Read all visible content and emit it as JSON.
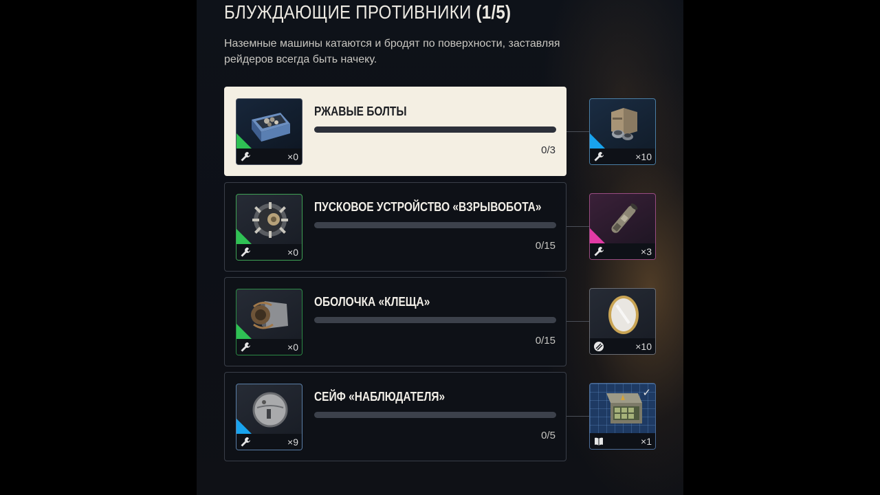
{
  "header": {
    "title": "БЛУЖДАЮЩИЕ ПРОТИВНИКИ",
    "step": "(1/5)",
    "description": "Наземные машины катаются и бродят по поверхности, заставляя рейдеров всегда быть начеку."
  },
  "requirements": [
    {
      "name": "РЖАВЫЕ БОЛТЫ",
      "owned": "×0",
      "progress_text": "0/3",
      "progress_fraction": 0,
      "item_icon": "bolts-bin-icon",
      "rarity": "uncommon",
      "active": true,
      "reward": {
        "count": "×10",
        "icon": "crate-with-cans-icon",
        "rarity": "rare",
        "type_icon": "wrench-icon"
      }
    },
    {
      "name": "ПУСКОВОЕ УСТРОЙСТВО «ВЗРЫВОБОТА»",
      "owned": "×0",
      "progress_text": "0/15",
      "progress_fraction": 0,
      "item_icon": "launcher-device-icon",
      "rarity": "uncommon",
      "active": false,
      "reward": {
        "count": "×3",
        "icon": "tube-icon",
        "rarity": "epic",
        "type_icon": "wrench-icon"
      }
    },
    {
      "name": "ОБОЛОЧКА «КЛЕЩА»",
      "owned": "×0",
      "progress_text": "0/15",
      "progress_fraction": 0,
      "item_icon": "tick-shell-icon",
      "rarity": "uncommon",
      "active": false,
      "reward": {
        "count": "×10",
        "icon": "coin-icon",
        "rarity": "common",
        "type_icon": "coin-stack-icon"
      }
    },
    {
      "name": "СЕЙФ «НАБЛЮДАТЕЛЯ»",
      "owned": "×9",
      "progress_text": "0/5",
      "progress_fraction": 0,
      "item_icon": "observer-safe-icon",
      "rarity": "rare",
      "active": false,
      "reward": {
        "count": "×1",
        "icon": "blueprint-case-icon",
        "rarity": "blueprint",
        "type_icon": "book-icon",
        "claimed": true
      }
    }
  ],
  "colors": {
    "uncommon": "#2fc154",
    "rare": "#18a3ee",
    "epic": "#e23aa4",
    "active_card": "#f4efe3"
  }
}
